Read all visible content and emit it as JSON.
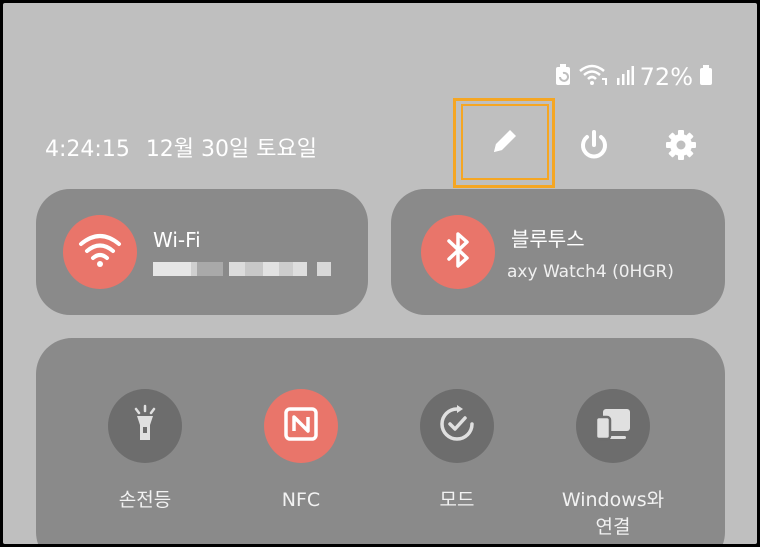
{
  "status_bar": {
    "battery_percent": "72%",
    "icons": [
      "battery-saver-icon",
      "wifi-calling-icon",
      "signal-icon",
      "battery-icon"
    ]
  },
  "header": {
    "time": "4:24:15",
    "date": "12월 30일 토요일",
    "highlight_color": "#f5a623"
  },
  "tiles": {
    "wifi": {
      "title": "Wi-Fi",
      "subtitle": ""
    },
    "bluetooth": {
      "title": "블루투스",
      "subtitle": "axy Watch4 (0HGR)"
    }
  },
  "quick_settings": [
    {
      "label": "손전등",
      "icon": "flashlight-icon",
      "active": false
    },
    {
      "label": "NFC",
      "icon": "nfc-icon",
      "active": true
    },
    {
      "label": "모드",
      "icon": "modes-icon",
      "active": false
    },
    {
      "label": "Windows와\n연결",
      "icon": "link-to-windows-icon",
      "active": false
    }
  ],
  "colors": {
    "accent": "#e9756a",
    "tile_bg": "#8a8a8a",
    "background": "#bfbfbf"
  }
}
